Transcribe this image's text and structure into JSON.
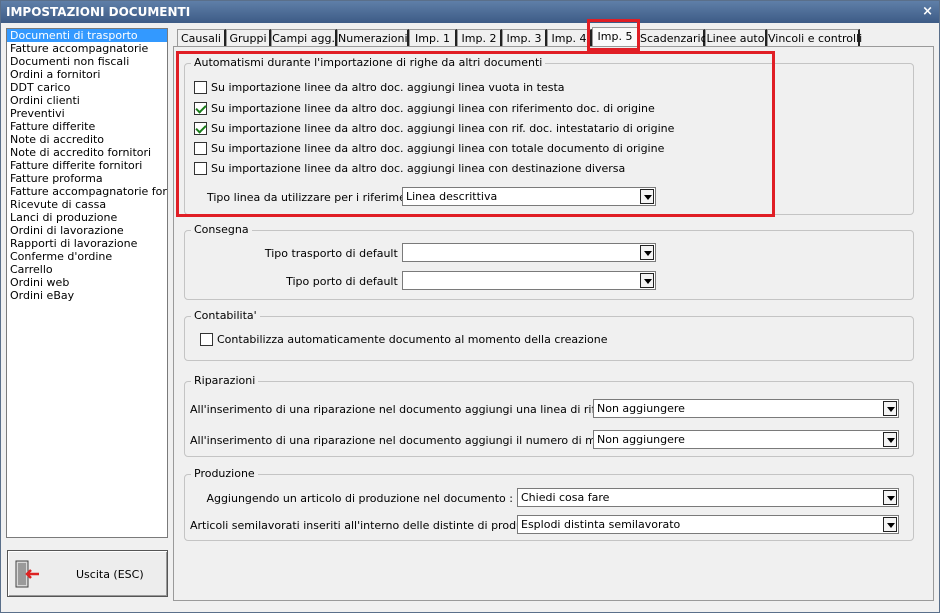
{
  "window": {
    "title": "IMPOSTAZIONI DOCUMENTI",
    "close_glyph": "×"
  },
  "sidebar": {
    "items": [
      "Documenti di trasporto",
      "Fatture accompagnatorie",
      "Documenti non fiscali",
      "Ordini a fornitori",
      "DDT carico",
      "Ordini clienti",
      "Preventivi",
      "Fatture differite",
      "Note di accredito",
      "Note di accredito fornitori",
      "Fatture differite fornitori",
      "Fatture proforma",
      "Fatture accompagnatorie fornito",
      "Ricevute di cassa",
      "Lanci di produzione",
      "Ordini di lavorazione",
      "Rapporti di lavorazione",
      "Conferme d'ordine",
      "Carrello",
      "Ordini web",
      "Ordini eBay"
    ],
    "selected_index": 0
  },
  "exit_button": {
    "label": "Uscita (ESC)",
    "icon": "exit-door-icon"
  },
  "tabs": {
    "items": [
      "Causali",
      "Gruppi",
      "Campi agg.",
      "Numerazioni",
      "Imp. 1",
      "Imp. 2",
      "Imp. 3",
      "Imp. 4",
      "Imp. 5",
      "Scadenzario",
      "Linee auto",
      "Vincoli e controlli"
    ],
    "active": "Imp. 5"
  },
  "automatismi": {
    "title": "Automatismi durante l'importazione di righe da altri documenti",
    "checks": [
      {
        "label": "Su importazione linee da altro doc. aggiungi linea vuota in testa",
        "checked": false
      },
      {
        "label": "Su importazione linee da altro doc. aggiungi linea con riferimento doc. di origine",
        "checked": true
      },
      {
        "label": "Su importazione linee da altro doc. aggiungi linea con rif. doc. intestatario di origine",
        "checked": true
      },
      {
        "label": "Su importazione linee da altro doc. aggiungi linea con totale documento di origine",
        "checked": false
      },
      {
        "label": "Su importazione linee da altro doc. aggiungi linea con destinazione diversa",
        "checked": false
      }
    ],
    "tipo_linea_label": "Tipo linea da utilizzare per i riferimenti :",
    "tipo_linea_value": "Linea descrittiva"
  },
  "consegna": {
    "title": "Consegna",
    "trasporto_label": "Tipo trasporto di default :",
    "trasporto_value": "",
    "porto_label": "Tipo porto di default :",
    "porto_value": ""
  },
  "contabilita": {
    "title": "Contabilita'",
    "check_label": "Contabilizza automaticamente documento al momento della creazione",
    "checked": false
  },
  "riparazioni": {
    "title": "Riparazioni",
    "row1_label": "All'inserimento di una riparazione nel documento aggiungi una linea di riferimento :",
    "row1_value": "Non aggiungere",
    "row2_label": "All'inserimento di una riparazione nel documento aggiungi il numero di matricola :",
    "row2_value": "Non aggiungere"
  },
  "produzione": {
    "title": "Produzione",
    "row1_label": "Aggiungendo un articolo di produzione nel documento :",
    "row1_value": "Chiedi cosa fare",
    "row2_label": "Articoli semilavorati inseriti all'interno delle distinte di produzione :",
    "row2_value": "Esplodi distinta semilavorato"
  },
  "colors": {
    "highlight": "#e01e25",
    "selection": "#3399ff",
    "titlebar": "#4a6892"
  }
}
